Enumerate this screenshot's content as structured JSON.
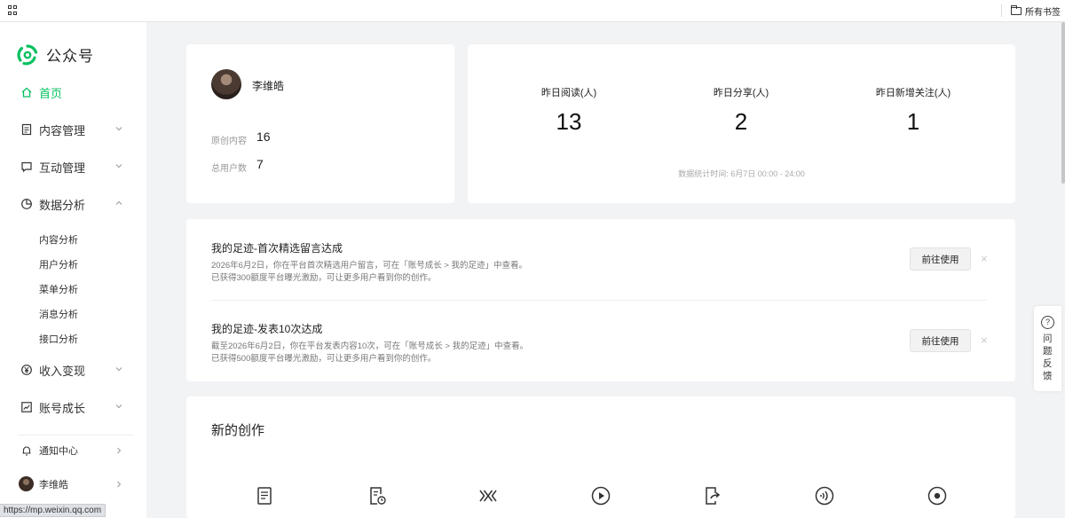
{
  "browser": {
    "bookmarks_label": "所有书签",
    "status_url": "https://mp.weixin.qq.com"
  },
  "sidebar": {
    "logo_text": "公众号",
    "home": "首页",
    "nav": [
      {
        "label": "内容管理",
        "expanded": false
      },
      {
        "label": "互动管理",
        "expanded": false
      },
      {
        "label": "数据分析",
        "expanded": true
      },
      {
        "label": "收入变现",
        "expanded": false
      },
      {
        "label": "账号成长",
        "expanded": false
      }
    ],
    "sub_items": [
      "内容分析",
      "用户分析",
      "菜单分析",
      "消息分析",
      "接口分析"
    ],
    "notification": "通知中心",
    "user": "李维皓",
    "accent_color": "#07c160"
  },
  "profile": {
    "name": "李维皓",
    "original_label": "原创内容",
    "original_value": "16",
    "users_label": "总用户数",
    "users_value": "7"
  },
  "stats": {
    "items": [
      {
        "label": "昨日阅读(人)",
        "value": "13"
      },
      {
        "label": "昨日分享(人)",
        "value": "2"
      },
      {
        "label": "昨日新增关注(人)",
        "value": "1"
      }
    ],
    "footnote": "数据统计时间: 6月7日 00:00 - 24:00"
  },
  "notices": [
    {
      "title": "我的足迹-首次精选留言达成",
      "line1": "2026年6月2日，你在平台首次精选用户留言，可在「账号成长 > 我的足迹」中查看。",
      "line2": "已获得300额度平台曝光激励，可让更多用户看到你的创作。",
      "button": "前往使用",
      "close": "×"
    },
    {
      "title": "我的足迹-发表10次达成",
      "line1": "截至2026年6月2日，你在平台发表内容10次，可在「账号成长 > 我的足迹」中查看。",
      "line2": "已获得500额度平台曝光激励，可让更多用户看到你的创作。",
      "button": "前往使用",
      "close": "×"
    }
  ],
  "create": {
    "title": "新的创作",
    "icons": [
      "article-icon",
      "scheduled-article-icon",
      "image-post-icon",
      "video-icon",
      "repost-icon",
      "audio-icon",
      "live-icon"
    ]
  },
  "feedback": {
    "label": "问题反馈",
    "icon_glyph": "?"
  }
}
